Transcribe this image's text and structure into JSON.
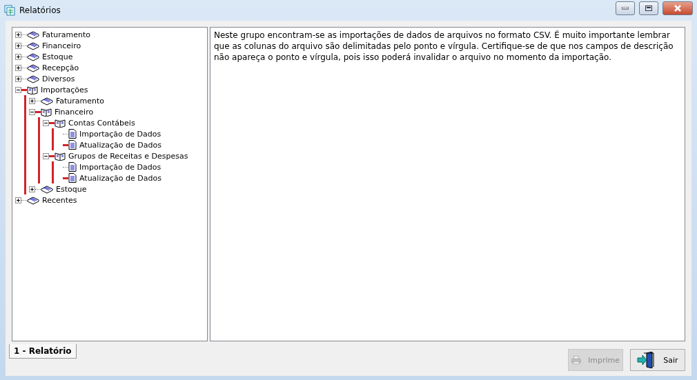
{
  "window": {
    "title": "Relatórios"
  },
  "tree": [
    {
      "label": "Faturamento",
      "kind": "folder",
      "expanded": false,
      "highlighted": false
    },
    {
      "label": "Financeiro",
      "kind": "folder",
      "expanded": false,
      "highlighted": false
    },
    {
      "label": "Estoque",
      "kind": "folder",
      "expanded": false,
      "highlighted": false
    },
    {
      "label": "Recepção",
      "kind": "folder",
      "expanded": false,
      "highlighted": false
    },
    {
      "label": "Diversos",
      "kind": "folder",
      "expanded": false,
      "highlighted": false
    },
    {
      "label": "Importações",
      "kind": "folder",
      "expanded": true,
      "highlighted": true,
      "children": [
        {
          "label": "Faturamento",
          "kind": "folder",
          "expanded": false,
          "highlighted": false
        },
        {
          "label": "Financeiro",
          "kind": "folder",
          "expanded": true,
          "highlighted": true,
          "children": [
            {
              "label": "Contas Contábeis",
              "kind": "folder",
              "expanded": true,
              "highlighted": true,
              "children": [
                {
                  "label": "Importação de Dados",
                  "kind": "doc",
                  "highlighted": false
                },
                {
                  "label": "Atualização de Dados",
                  "kind": "doc",
                  "highlighted": true
                }
              ]
            },
            {
              "label": "Grupos de Receitas e Despesas",
              "kind": "folder",
              "expanded": true,
              "highlighted": true,
              "children": [
                {
                  "label": "Importação de Dados",
                  "kind": "doc",
                  "highlighted": false
                },
                {
                  "label": "Atualização de Dados",
                  "kind": "doc",
                  "highlighted": true
                }
              ]
            }
          ]
        },
        {
          "label": "Estoque",
          "kind": "folder",
          "expanded": false,
          "highlighted": false
        }
      ]
    },
    {
      "label": "Recentes",
      "kind": "folder",
      "expanded": false,
      "highlighted": false
    }
  ],
  "description": "Neste grupo encontram-se as importações de dados de arquivos no formato CSV. É muito importante lembrar que as colunas do arquivo são delimitadas pelo ponto e vírgula. Certifique-se de que nos campos de descrição não apareça o ponto e vírgula, pois isso poderá invalidar o arquivo no momento da importação.",
  "tabs": [
    {
      "label": "1 - Relatório",
      "selected": true
    }
  ],
  "buttons": [
    {
      "label": "Imprime",
      "kind": "print",
      "disabled": true
    },
    {
      "label": "Sair",
      "kind": "exit",
      "disabled": false
    }
  ]
}
